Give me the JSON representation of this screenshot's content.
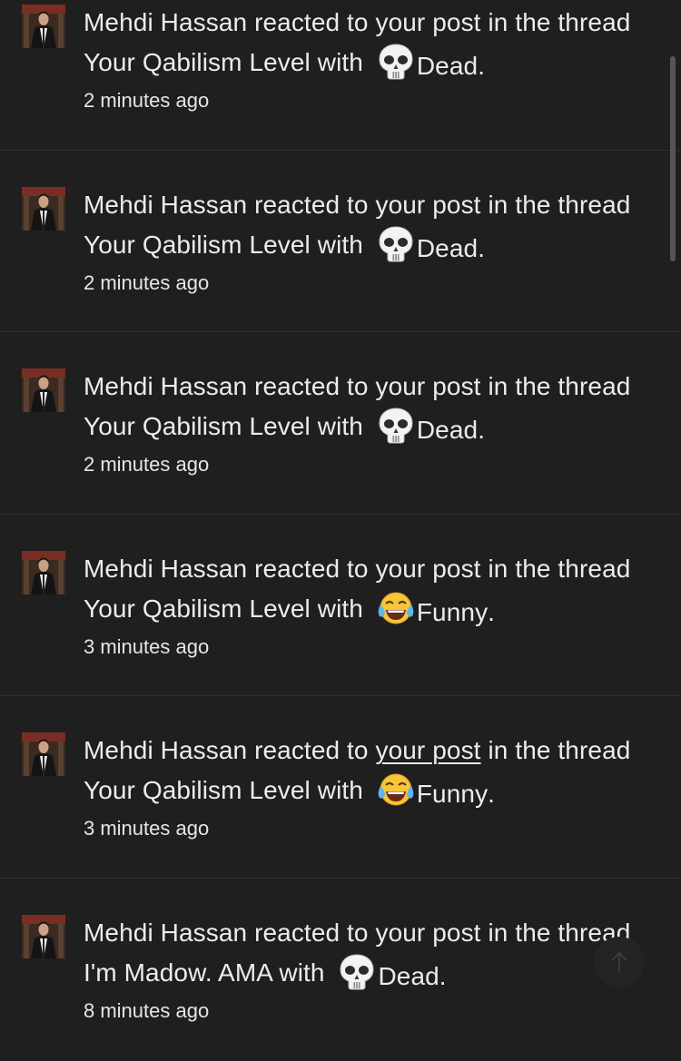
{
  "alerts": [
    {
      "user": "Mehdi Hassan",
      "mid_a": " reacted to ",
      "link": "your post",
      "mid_b": " in the thread ",
      "thread": "Your Qabilism Level",
      "with": " with ",
      "reaction_icon": "skull-icon",
      "reaction": "Dead",
      "end": ".",
      "time": "2 minutes ago"
    },
    {
      "user": "Mehdi Hassan",
      "mid_a": " reacted to ",
      "link": "your post",
      "mid_b": " in the thread ",
      "thread": "Your Qabilism Level",
      "with": " with ",
      "reaction_icon": "skull-icon",
      "reaction": "Dead",
      "end": ".",
      "time": "2 minutes ago"
    },
    {
      "user": "Mehdi Hassan",
      "mid_a": " reacted to ",
      "link": "your post",
      "mid_b": " in the thread ",
      "thread": "Your Qabilism Level",
      "with": " with ",
      "reaction_icon": "skull-icon",
      "reaction": "Dead",
      "end": ".",
      "time": "2 minutes ago"
    },
    {
      "user": "Mehdi Hassan",
      "mid_a": " reacted to ",
      "link": "your post",
      "mid_b": " in the thread ",
      "thread": "Your Qabilism Level",
      "with": " with ",
      "reaction_icon": "tears-of-joy-icon",
      "reaction": "Funny",
      "end": ".",
      "time": "3 minutes ago"
    },
    {
      "user": "Mehdi Hassan",
      "mid_a": " reacted to ",
      "link": "your post",
      "mid_b": " in the thread ",
      "thread": "Your Qabilism Level",
      "with": " with ",
      "reaction_icon": "tears-of-joy-icon",
      "reaction": "Funny",
      "end": ".",
      "time": "3 minutes ago"
    },
    {
      "user": "Mehdi Hassan",
      "mid_a": " reacted to ",
      "link": "your post",
      "mid_b": " in the thread ",
      "thread": "I'm Madow. AMA",
      "with": " with ",
      "reaction_icon": "skull-icon",
      "reaction": "Dead",
      "end": ".",
      "time": "8 minutes ago"
    }
  ],
  "colors": {
    "background": "#1f1f1f",
    "divider": "#303030",
    "text": "#ececec"
  }
}
